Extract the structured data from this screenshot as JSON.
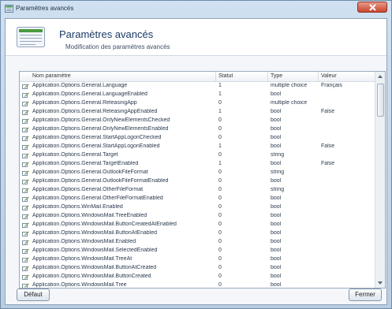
{
  "window": {
    "title": "Paramètres avancés",
    "close_icon": "close-icon"
  },
  "header": {
    "title": "Paramètres avancés",
    "subtitle": "Modification des paramètres avancés",
    "icon": "settings-list-icon"
  },
  "table": {
    "columns": [
      "Nom paramètre",
      "Statut",
      "Type",
      "Valeur"
    ],
    "rows": [
      {
        "name": "Application.Options.General.Language",
        "status": "1",
        "type": "multiple choice",
        "value": "Français"
      },
      {
        "name": "Application.Options.General.LanguageEnabled",
        "status": "1",
        "type": "bool",
        "value": ""
      },
      {
        "name": "Application.Options.General.ReleasingApp",
        "status": "0",
        "type": "multiple choice",
        "value": ""
      },
      {
        "name": "Application.Options.General.ReleasingAppEnabled",
        "status": "1",
        "type": "bool",
        "value": "False"
      },
      {
        "name": "Application.Options.General.OnlyNewElementsChecked",
        "status": "0",
        "type": "bool",
        "value": ""
      },
      {
        "name": "Application.Options.General.OnlyNewElementsEnabled",
        "status": "0",
        "type": "bool",
        "value": ""
      },
      {
        "name": "Application.Options.General.StartAppLogonChecked",
        "status": "0",
        "type": "bool",
        "value": ""
      },
      {
        "name": "Application.Options.General.StartAppLogonEnabled",
        "status": "1",
        "type": "bool",
        "value": "False"
      },
      {
        "name": "Application.Options.General.Target",
        "status": "0",
        "type": "string",
        "value": ""
      },
      {
        "name": "Application.Options.General.TargetEnabled",
        "status": "1",
        "type": "bool",
        "value": "False"
      },
      {
        "name": "Application.Options.General.OutlookFileFormat",
        "status": "0",
        "type": "string",
        "value": ""
      },
      {
        "name": "Application.Options.General.OutlookFileFormatEnabled",
        "status": "0",
        "type": "bool",
        "value": ""
      },
      {
        "name": "Application.Options.General.OtherFileFormat",
        "status": "0",
        "type": "string",
        "value": ""
      },
      {
        "name": "Application.Options.General.OtherFileFormatEnabled",
        "status": "0",
        "type": "bool",
        "value": ""
      },
      {
        "name": "Application.Options.WinMail.Enabled",
        "status": "0",
        "type": "bool",
        "value": ""
      },
      {
        "name": "Application.Options.WindowsMail.TreeEnabled",
        "status": "0",
        "type": "bool",
        "value": ""
      },
      {
        "name": "Application.Options.WindowsMail.ButtonCreatedAtEnabled",
        "status": "0",
        "type": "bool",
        "value": ""
      },
      {
        "name": "Application.Options.WindowsMail.ButtonAtEnabled",
        "status": "0",
        "type": "bool",
        "value": ""
      },
      {
        "name": "Application.Options.WindowsMail.Enabled",
        "status": "0",
        "type": "bool",
        "value": ""
      },
      {
        "name": "Application.Options.WindowsMail.SelectedEnabled",
        "status": "0",
        "type": "bool",
        "value": ""
      },
      {
        "name": "Application.Options.WindowsMail.TreeAt",
        "status": "0",
        "type": "bool",
        "value": ""
      },
      {
        "name": "Application.Options.WindowsMail.ButtonAtCreated",
        "status": "0",
        "type": "bool",
        "value": ""
      },
      {
        "name": "Application.Options.WindowsMail.ButtonCreated",
        "status": "0",
        "type": "bool",
        "value": ""
      },
      {
        "name": "Application.Options.WindowsMail.Tree",
        "status": "0",
        "type": "bool",
        "value": ""
      }
    ]
  },
  "footer": {
    "default_label": "Défaut",
    "close_label": "Fermer"
  },
  "colors": {
    "accent": "#1b3a66",
    "row_icon": "#6a9a3a"
  }
}
